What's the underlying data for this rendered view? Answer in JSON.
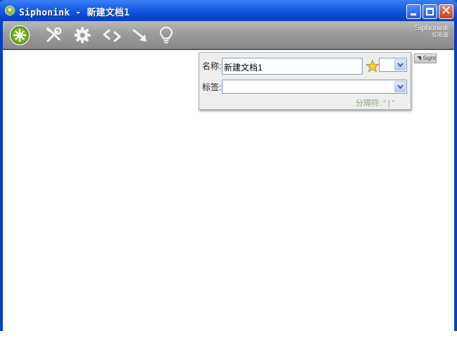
{
  "window": {
    "title": "Siphonink  -  新建文档1"
  },
  "toolbar": {
    "items": [
      {
        "name": "logo-icon"
      },
      {
        "name": "tools-icon"
      },
      {
        "name": "gear-icon"
      },
      {
        "name": "code-icon"
      },
      {
        "name": "arrow-icon"
      },
      {
        "name": "lightbulb-icon"
      }
    ],
    "brand_en": "Siphonink",
    "brand_cn": "虹吸墨"
  },
  "sight_tab": "◥ Sight",
  "doc_panel": {
    "name_label": "名称:",
    "name_value": "新建文档1",
    "tag_label": "标签:",
    "tag_value": "",
    "separator_hint": "分隔符: “ | ”"
  },
  "colors": {
    "titlebar": "#0b4cd7",
    "toolbar": "#9c9c9c",
    "hint": "#8aa67e",
    "star": "#e8c33a"
  }
}
